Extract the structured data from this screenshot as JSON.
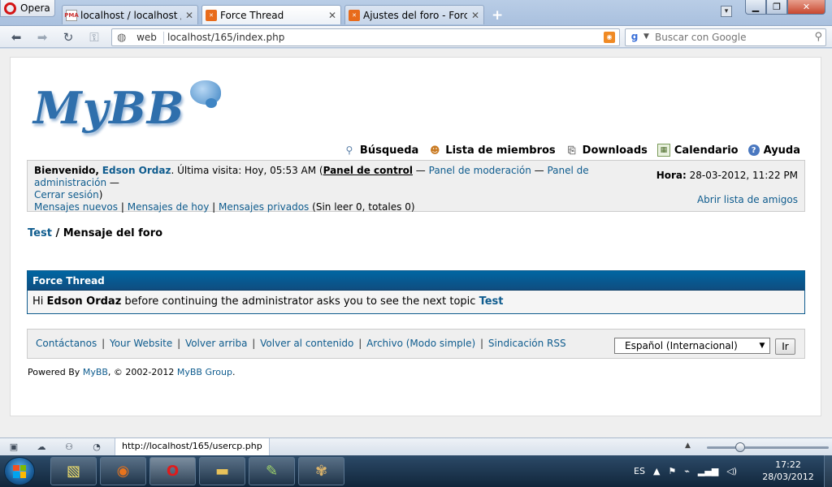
{
  "browser": {
    "menu_label": "Opera",
    "tabs": [
      {
        "title": "localhost / localhost / ...",
        "favicon": "pma",
        "active": false
      },
      {
        "title": "Force Thread",
        "favicon": "xmpp",
        "active": true
      },
      {
        "title": "Ajustes del foro - Force...",
        "favicon": "xmpp",
        "active": false
      }
    ],
    "tab_close": "✕",
    "new_tab": "+",
    "address": {
      "zone": "web",
      "url": "localhost/165/index.php"
    },
    "search_placeholder": "Buscar con Google",
    "status_url": "http://localhost/165/usercp.php",
    "zoom_level": 0.25
  },
  "forum": {
    "logo_text": "MyBB",
    "top_links": [
      {
        "label": "Búsqueda",
        "icon": "search-icon"
      },
      {
        "label": "Lista de miembros",
        "icon": "members-icon"
      },
      {
        "label": "Downloads",
        "icon": "downloads-icon"
      },
      {
        "label": "Calendario",
        "icon": "calendar-icon"
      },
      {
        "label": "Ayuda",
        "icon": "help-icon"
      }
    ],
    "welcome": {
      "greeting": "Bienvenido,",
      "user": "Edson Ordaz",
      "last_visit": ". Última visita: Hoy, 05:53 AM (",
      "control_panel": "Panel de control",
      "dash1": " — ",
      "moderation": "Panel de moderación",
      "dash2": " — ",
      "admin": "Panel de administración",
      "dash3": " —",
      "logout": "Cerrar sesión",
      "close_paren": ")",
      "new_posts": "Mensajes nuevos",
      "todays_posts": "Mensajes de hoy",
      "private_messages": "Mensajes privados",
      "pm_counts": "(Sin leer 0, totales 0)",
      "time_label": "Hora:",
      "time_value": "28-03-2012, 11:22 PM",
      "buddy_list": "Abrir lista de amigos",
      "pipe": "|"
    },
    "breadcrumb": {
      "root": "Test",
      "separator": "/",
      "current": "Mensaje del foro"
    },
    "thread_box": {
      "title": "Force Thread",
      "prefix": "Hi",
      "user": "Edson Ordaz",
      "message": "before continuing the administrator asks you to see the next topic",
      "topic": "Test"
    },
    "footer_links": [
      "Contáctanos",
      "Your Website",
      "Volver arriba",
      "Volver al contenido",
      "Archivo (Modo simple)",
      "Sindicación RSS"
    ],
    "language_selected": "Español (Internacional)",
    "go_button": "Ir",
    "powered": {
      "prefix": "Powered By",
      "mybb": "MyBB",
      "copy": ", © 2002-2012",
      "group": "MyBB Group",
      "end": "."
    }
  },
  "taskbar": {
    "language": "ES",
    "clock_time": "17:22",
    "clock_date": "28/03/2012"
  },
  "colors": {
    "link": "#0f5c8e",
    "thead": "#0066a2"
  }
}
